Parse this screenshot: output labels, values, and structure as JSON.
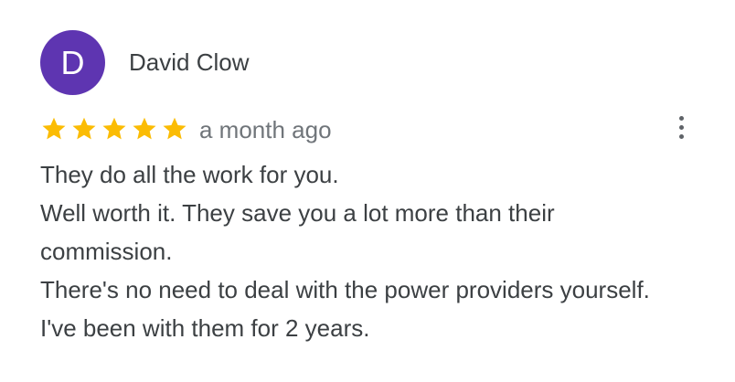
{
  "review": {
    "avatar_initial": "D",
    "avatar_color": "#5e35b1",
    "author": "David Clow",
    "rating": 5,
    "rating_max": 5,
    "star_color": "#fbbc04",
    "date": "a month ago",
    "menu_icon": "more-vert-icon",
    "lines": [
      "They do all the work for you.",
      "Well worth it. They save you a lot more than their",
      "commission.",
      "There's no need to deal with the power providers yourself.",
      "I've been with them for 2 years."
    ]
  }
}
